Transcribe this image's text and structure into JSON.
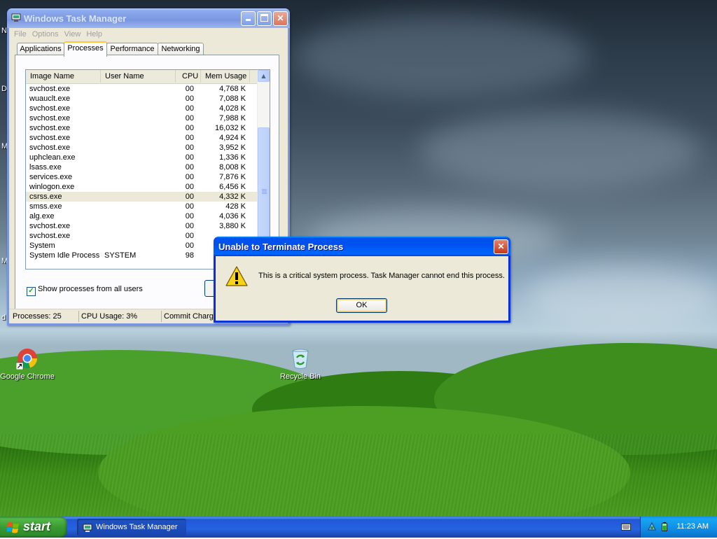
{
  "desktop": {
    "icons": [
      {
        "label": "Google Chrome"
      },
      {
        "label": "Recycle Bin"
      }
    ],
    "edge_letters": [
      "N",
      "D",
      "M",
      "M",
      "d"
    ]
  },
  "task_manager": {
    "title": "Windows Task Manager",
    "menu": [
      "File",
      "Options",
      "View",
      "Help"
    ],
    "tabs": [
      "Applications",
      "Processes",
      "Performance",
      "Networking"
    ],
    "active_tab": "Processes",
    "columns": [
      "Image Name",
      "User Name",
      "CPU",
      "Mem Usage"
    ],
    "processes": [
      {
        "name": "svchost.exe",
        "user": "",
        "cpu": "00",
        "mem": "4,768 K"
      },
      {
        "name": "wuauclt.exe",
        "user": "",
        "cpu": "00",
        "mem": "7,088 K"
      },
      {
        "name": "svchost.exe",
        "user": "",
        "cpu": "00",
        "mem": "4,028 K"
      },
      {
        "name": "svchost.exe",
        "user": "",
        "cpu": "00",
        "mem": "7,988 K"
      },
      {
        "name": "svchost.exe",
        "user": "",
        "cpu": "00",
        "mem": "16,032 K"
      },
      {
        "name": "svchost.exe",
        "user": "",
        "cpu": "00",
        "mem": "4,924 K"
      },
      {
        "name": "svchost.exe",
        "user": "",
        "cpu": "00",
        "mem": "3,952 K"
      },
      {
        "name": "uphclean.exe",
        "user": "",
        "cpu": "00",
        "mem": "1,336 K"
      },
      {
        "name": "lsass.exe",
        "user": "",
        "cpu": "00",
        "mem": "8,008 K"
      },
      {
        "name": "services.exe",
        "user": "",
        "cpu": "00",
        "mem": "7,876 K"
      },
      {
        "name": "winlogon.exe",
        "user": "",
        "cpu": "00",
        "mem": "6,456 K"
      },
      {
        "name": "csrss.exe",
        "user": "",
        "cpu": "00",
        "mem": "4,332 K"
      },
      {
        "name": "smss.exe",
        "user": "",
        "cpu": "00",
        "mem": "428 K"
      },
      {
        "name": "alg.exe",
        "user": "",
        "cpu": "00",
        "mem": "4,036 K"
      },
      {
        "name": "svchost.exe",
        "user": "",
        "cpu": "00",
        "mem": "3,880 K"
      },
      {
        "name": "svchost.exe",
        "user": "",
        "cpu": "00",
        "mem": ""
      },
      {
        "name": "System",
        "user": "",
        "cpu": "00",
        "mem": ""
      },
      {
        "name": "System Idle Process",
        "user": "SYSTEM",
        "cpu": "98",
        "mem": ""
      }
    ],
    "selected_process": "csrss.exe",
    "show_all_users": {
      "label": "Show processes from all users",
      "checked": true
    },
    "status": {
      "processes": "Processes: 25",
      "cpu": "CPU Usage: 3%",
      "commit": "Commit Charge"
    }
  },
  "dialog": {
    "title": "Unable to Terminate Process",
    "message": "This is a critical system process.  Task Manager cannot end this process.",
    "ok_label": "OK",
    "icon": "warning-icon"
  },
  "taskbar": {
    "start_label": "start",
    "tasks": [
      {
        "label": "Windows Task Manager"
      }
    ],
    "clock": "11:23 AM"
  },
  "colors": {
    "title_active": "#0053ee",
    "title_inactive": "#7a96df",
    "window_face": "#ece9d8",
    "start_green": "#3a9b33",
    "taskbar_blue": "#2457d6"
  }
}
